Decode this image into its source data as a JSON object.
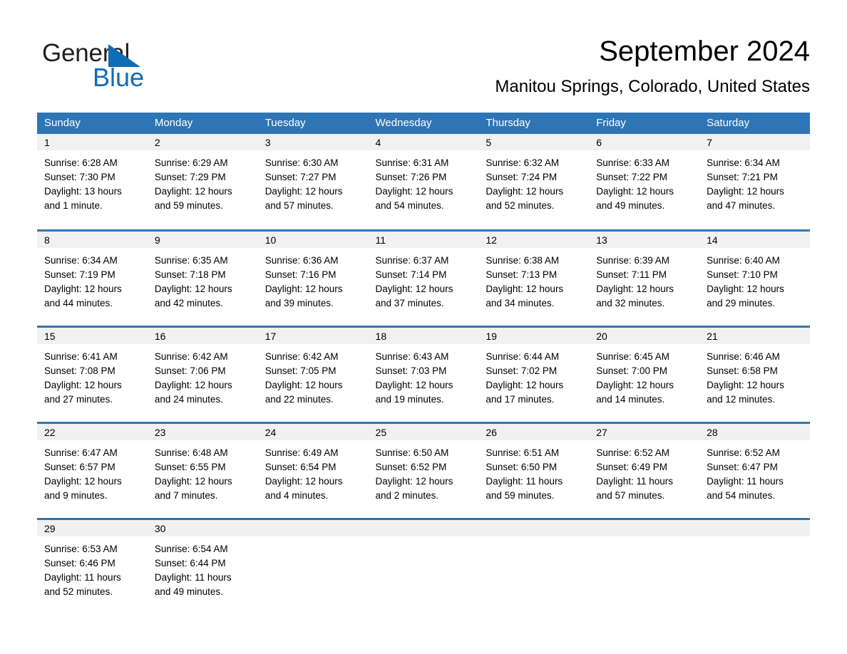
{
  "brand": {
    "logo_text_primary": "General",
    "logo_text_secondary": "Blue",
    "logo_icon": "triangle-flag-icon",
    "accent_color": "#0f6cb6"
  },
  "header": {
    "month_title": "September 2024",
    "location": "Manitou Springs, Colorado, United States"
  },
  "theme": {
    "header_blue": "#2e75b6",
    "row_divider_blue": "#2e75b6",
    "daynum_band_gray": "#f1f1f1"
  },
  "calendar": {
    "weekday_headers": [
      "Sunday",
      "Monday",
      "Tuesday",
      "Wednesday",
      "Thursday",
      "Friday",
      "Saturday"
    ],
    "weeks": [
      [
        {
          "day": "1",
          "sunrise": "Sunrise: 6:28 AM",
          "sunset": "Sunset: 7:30 PM",
          "daylight_line1": "Daylight: 13 hours",
          "daylight_line2": "and 1 minute."
        },
        {
          "day": "2",
          "sunrise": "Sunrise: 6:29 AM",
          "sunset": "Sunset: 7:29 PM",
          "daylight_line1": "Daylight: 12 hours",
          "daylight_line2": "and 59 minutes."
        },
        {
          "day": "3",
          "sunrise": "Sunrise: 6:30 AM",
          "sunset": "Sunset: 7:27 PM",
          "daylight_line1": "Daylight: 12 hours",
          "daylight_line2": "and 57 minutes."
        },
        {
          "day": "4",
          "sunrise": "Sunrise: 6:31 AM",
          "sunset": "Sunset: 7:26 PM",
          "daylight_line1": "Daylight: 12 hours",
          "daylight_line2": "and 54 minutes."
        },
        {
          "day": "5",
          "sunrise": "Sunrise: 6:32 AM",
          "sunset": "Sunset: 7:24 PM",
          "daylight_line1": "Daylight: 12 hours",
          "daylight_line2": "and 52 minutes."
        },
        {
          "day": "6",
          "sunrise": "Sunrise: 6:33 AM",
          "sunset": "Sunset: 7:22 PM",
          "daylight_line1": "Daylight: 12 hours",
          "daylight_line2": "and 49 minutes."
        },
        {
          "day": "7",
          "sunrise": "Sunrise: 6:34 AM",
          "sunset": "Sunset: 7:21 PM",
          "daylight_line1": "Daylight: 12 hours",
          "daylight_line2": "and 47 minutes."
        }
      ],
      [
        {
          "day": "8",
          "sunrise": "Sunrise: 6:34 AM",
          "sunset": "Sunset: 7:19 PM",
          "daylight_line1": "Daylight: 12 hours",
          "daylight_line2": "and 44 minutes."
        },
        {
          "day": "9",
          "sunrise": "Sunrise: 6:35 AM",
          "sunset": "Sunset: 7:18 PM",
          "daylight_line1": "Daylight: 12 hours",
          "daylight_line2": "and 42 minutes."
        },
        {
          "day": "10",
          "sunrise": "Sunrise: 6:36 AM",
          "sunset": "Sunset: 7:16 PM",
          "daylight_line1": "Daylight: 12 hours",
          "daylight_line2": "and 39 minutes."
        },
        {
          "day": "11",
          "sunrise": "Sunrise: 6:37 AM",
          "sunset": "Sunset: 7:14 PM",
          "daylight_line1": "Daylight: 12 hours",
          "daylight_line2": "and 37 minutes."
        },
        {
          "day": "12",
          "sunrise": "Sunrise: 6:38 AM",
          "sunset": "Sunset: 7:13 PM",
          "daylight_line1": "Daylight: 12 hours",
          "daylight_line2": "and 34 minutes."
        },
        {
          "day": "13",
          "sunrise": "Sunrise: 6:39 AM",
          "sunset": "Sunset: 7:11 PM",
          "daylight_line1": "Daylight: 12 hours",
          "daylight_line2": "and 32 minutes."
        },
        {
          "day": "14",
          "sunrise": "Sunrise: 6:40 AM",
          "sunset": "Sunset: 7:10 PM",
          "daylight_line1": "Daylight: 12 hours",
          "daylight_line2": "and 29 minutes."
        }
      ],
      [
        {
          "day": "15",
          "sunrise": "Sunrise: 6:41 AM",
          "sunset": "Sunset: 7:08 PM",
          "daylight_line1": "Daylight: 12 hours",
          "daylight_line2": "and 27 minutes."
        },
        {
          "day": "16",
          "sunrise": "Sunrise: 6:42 AM",
          "sunset": "Sunset: 7:06 PM",
          "daylight_line1": "Daylight: 12 hours",
          "daylight_line2": "and 24 minutes."
        },
        {
          "day": "17",
          "sunrise": "Sunrise: 6:42 AM",
          "sunset": "Sunset: 7:05 PM",
          "daylight_line1": "Daylight: 12 hours",
          "daylight_line2": "and 22 minutes."
        },
        {
          "day": "18",
          "sunrise": "Sunrise: 6:43 AM",
          "sunset": "Sunset: 7:03 PM",
          "daylight_line1": "Daylight: 12 hours",
          "daylight_line2": "and 19 minutes."
        },
        {
          "day": "19",
          "sunrise": "Sunrise: 6:44 AM",
          "sunset": "Sunset: 7:02 PM",
          "daylight_line1": "Daylight: 12 hours",
          "daylight_line2": "and 17 minutes."
        },
        {
          "day": "20",
          "sunrise": "Sunrise: 6:45 AM",
          "sunset": "Sunset: 7:00 PM",
          "daylight_line1": "Daylight: 12 hours",
          "daylight_line2": "and 14 minutes."
        },
        {
          "day": "21",
          "sunrise": "Sunrise: 6:46 AM",
          "sunset": "Sunset: 6:58 PM",
          "daylight_line1": "Daylight: 12 hours",
          "daylight_line2": "and 12 minutes."
        }
      ],
      [
        {
          "day": "22",
          "sunrise": "Sunrise: 6:47 AM",
          "sunset": "Sunset: 6:57 PM",
          "daylight_line1": "Daylight: 12 hours",
          "daylight_line2": "and 9 minutes."
        },
        {
          "day": "23",
          "sunrise": "Sunrise: 6:48 AM",
          "sunset": "Sunset: 6:55 PM",
          "daylight_line1": "Daylight: 12 hours",
          "daylight_line2": "and 7 minutes."
        },
        {
          "day": "24",
          "sunrise": "Sunrise: 6:49 AM",
          "sunset": "Sunset: 6:54 PM",
          "daylight_line1": "Daylight: 12 hours",
          "daylight_line2": "and 4 minutes."
        },
        {
          "day": "25",
          "sunrise": "Sunrise: 6:50 AM",
          "sunset": "Sunset: 6:52 PM",
          "daylight_line1": "Daylight: 12 hours",
          "daylight_line2": "and 2 minutes."
        },
        {
          "day": "26",
          "sunrise": "Sunrise: 6:51 AM",
          "sunset": "Sunset: 6:50 PM",
          "daylight_line1": "Daylight: 11 hours",
          "daylight_line2": "and 59 minutes."
        },
        {
          "day": "27",
          "sunrise": "Sunrise: 6:52 AM",
          "sunset": "Sunset: 6:49 PM",
          "daylight_line1": "Daylight: 11 hours",
          "daylight_line2": "and 57 minutes."
        },
        {
          "day": "28",
          "sunrise": "Sunrise: 6:52 AM",
          "sunset": "Sunset: 6:47 PM",
          "daylight_line1": "Daylight: 11 hours",
          "daylight_line2": "and 54 minutes."
        }
      ],
      [
        {
          "day": "29",
          "sunrise": "Sunrise: 6:53 AM",
          "sunset": "Sunset: 6:46 PM",
          "daylight_line1": "Daylight: 11 hours",
          "daylight_line2": "and 52 minutes."
        },
        {
          "day": "30",
          "sunrise": "Sunrise: 6:54 AM",
          "sunset": "Sunset: 6:44 PM",
          "daylight_line1": "Daylight: 11 hours",
          "daylight_line2": "and 49 minutes."
        },
        {
          "day": "",
          "sunrise": "",
          "sunset": "",
          "daylight_line1": "",
          "daylight_line2": ""
        },
        {
          "day": "",
          "sunrise": "",
          "sunset": "",
          "daylight_line1": "",
          "daylight_line2": ""
        },
        {
          "day": "",
          "sunrise": "",
          "sunset": "",
          "daylight_line1": "",
          "daylight_line2": ""
        },
        {
          "day": "",
          "sunrise": "",
          "sunset": "",
          "daylight_line1": "",
          "daylight_line2": ""
        },
        {
          "day": "",
          "sunrise": "",
          "sunset": "",
          "daylight_line1": "",
          "daylight_line2": ""
        }
      ]
    ]
  }
}
